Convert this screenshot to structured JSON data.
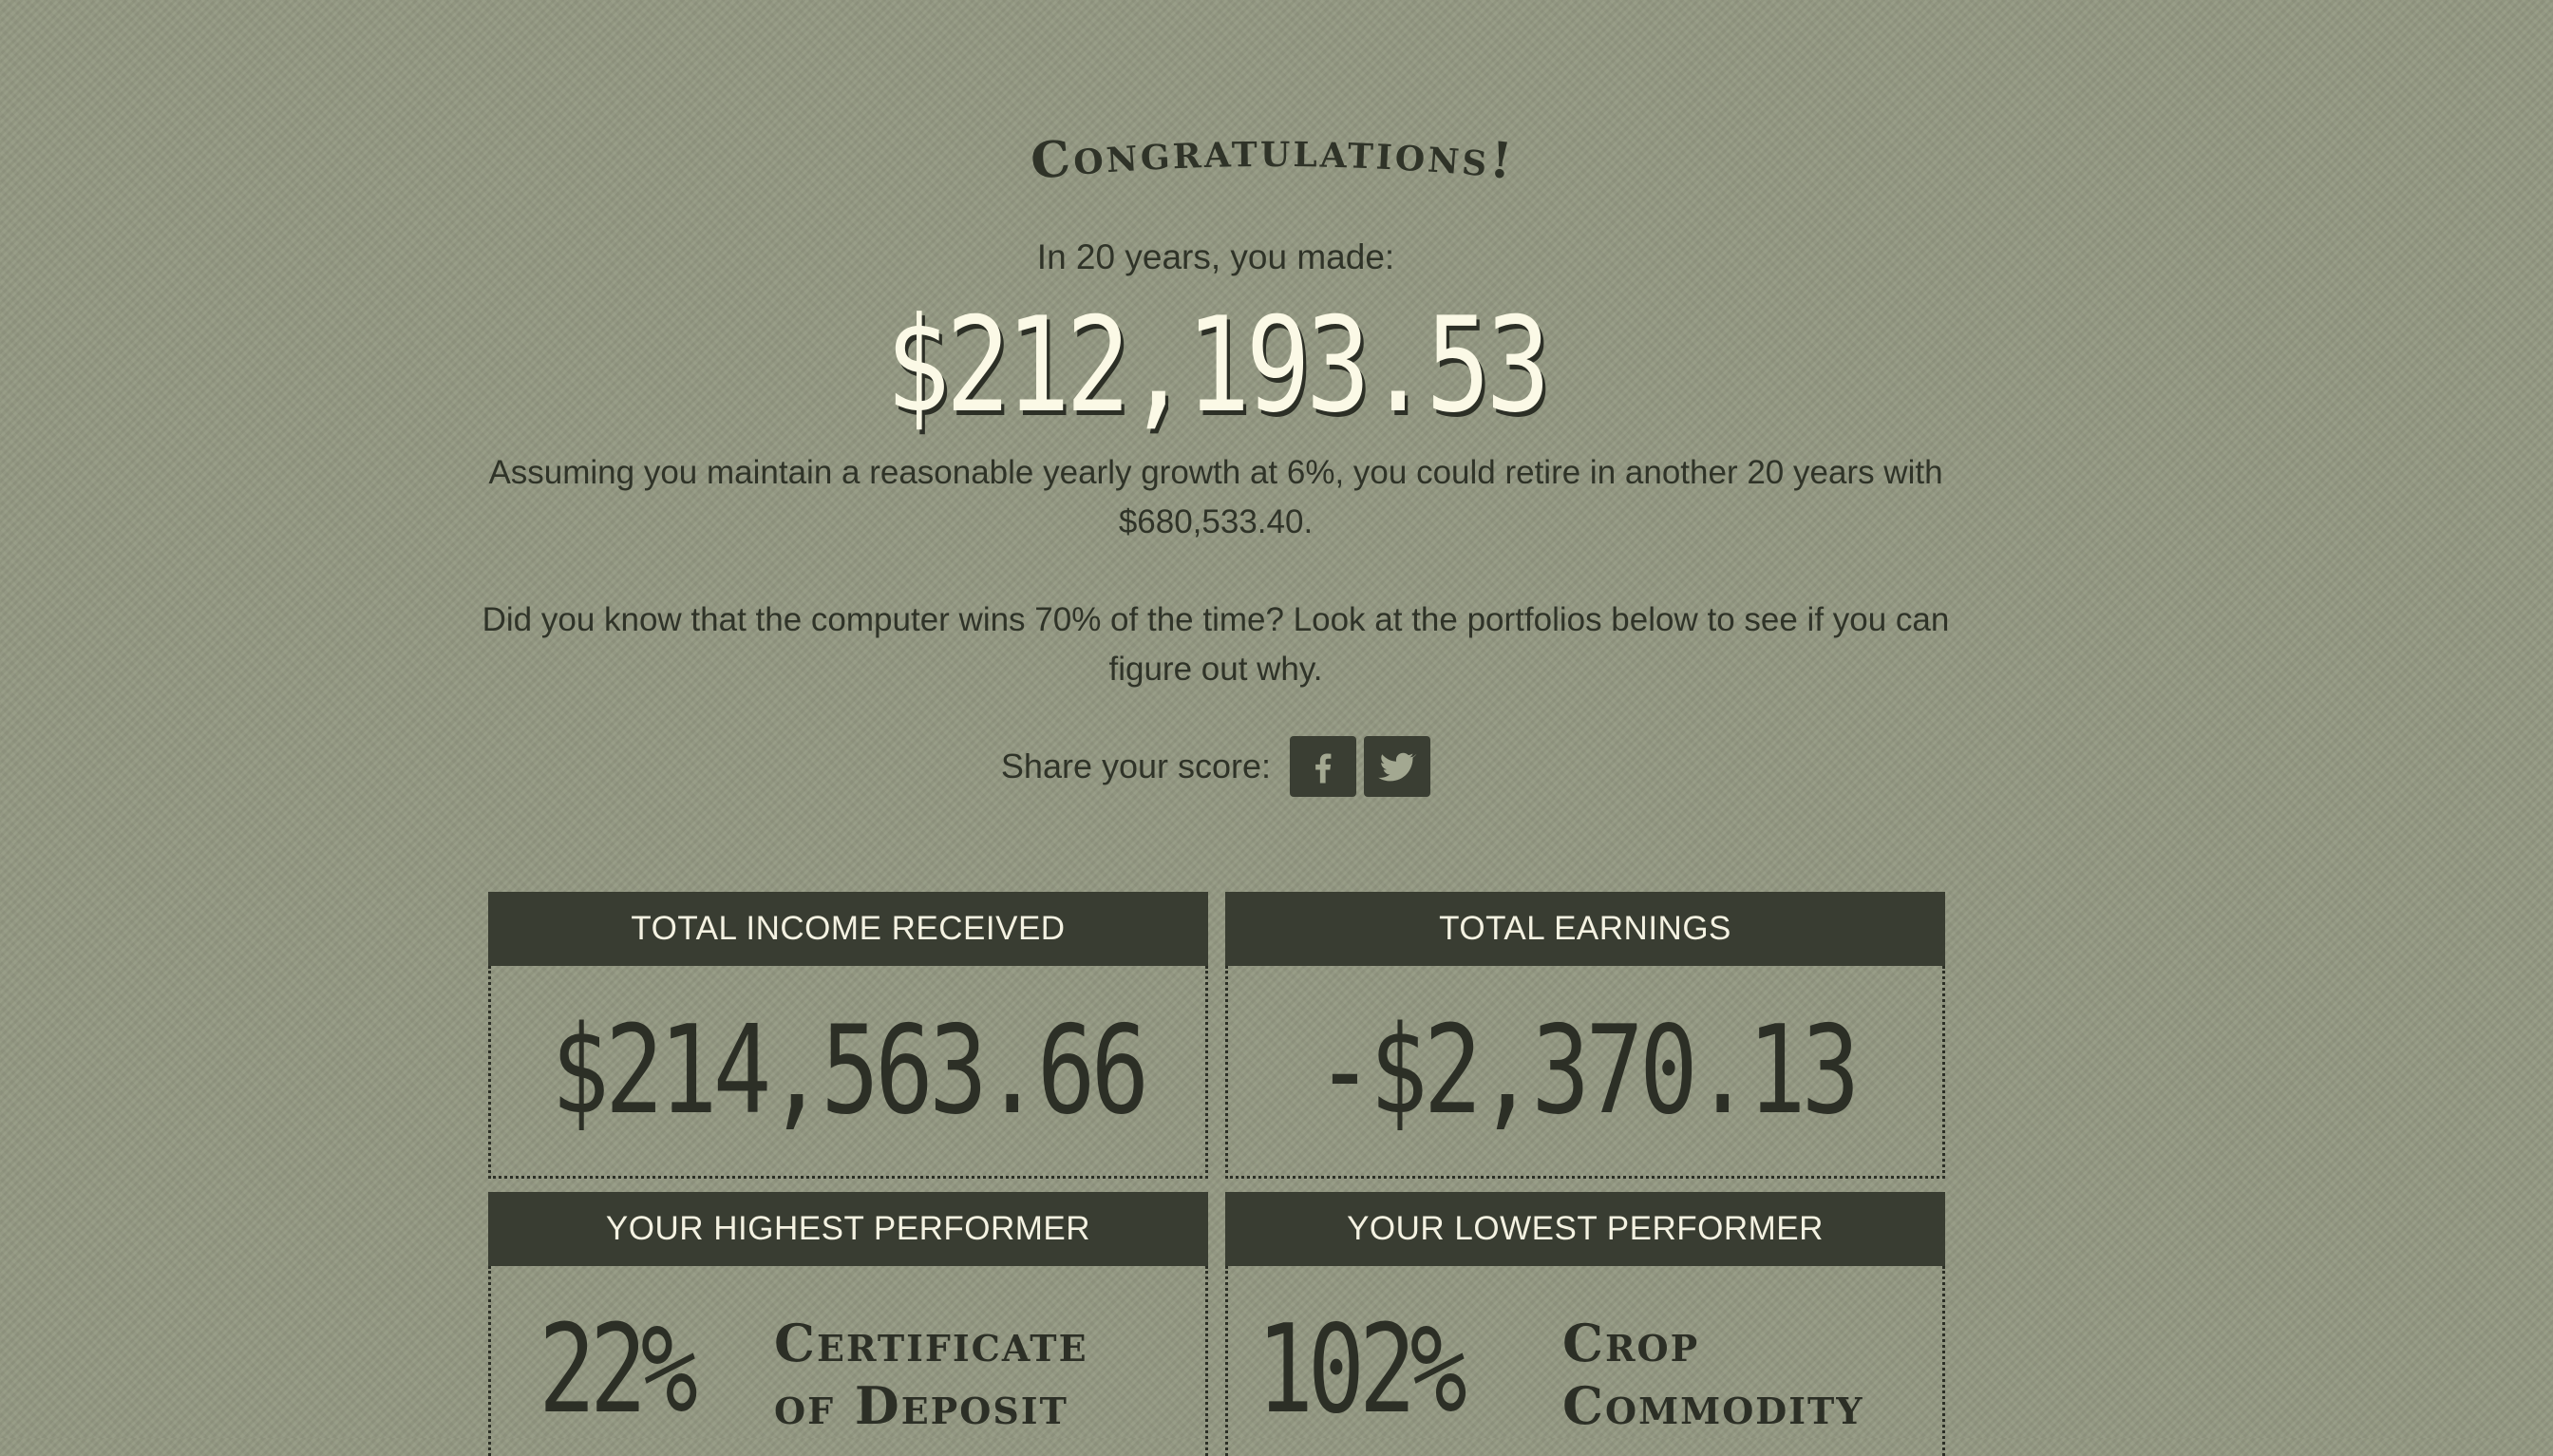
{
  "heading": "Congratulations!",
  "intro": "In 20 years, you made:",
  "total_made": "$212,193.53",
  "retire_text": "Assuming you maintain a reasonable yearly growth at 6%, you could retire in another 20 years with $680,533.40.",
  "did_you_know_text": "Did you know that the computer wins 70% of the time? Look at the portfolios below to see if you can figure out why.",
  "share": {
    "label": "Share your score:",
    "buttons": [
      {
        "icon": "facebook-icon"
      },
      {
        "icon": "twitter-icon"
      }
    ]
  },
  "cards": {
    "income": {
      "label": "Total Income Received",
      "value": "$214,563.66"
    },
    "earnings": {
      "label": "Total Earnings",
      "value": "-$2,370.13"
    },
    "highest": {
      "label": "Your Highest Performer",
      "pct": "22%",
      "name_line1": "Certificate",
      "name_line2": "of Deposit"
    },
    "lowest": {
      "label": "Your Lowest Performer",
      "pct": "102%",
      "name_line1": "Crop",
      "name_line2": "Commodity"
    }
  },
  "colors": {
    "background": "#939882",
    "card_header": "#393d32",
    "amount_text": "#fbf9e6",
    "dark_text": "#2f3328"
  }
}
